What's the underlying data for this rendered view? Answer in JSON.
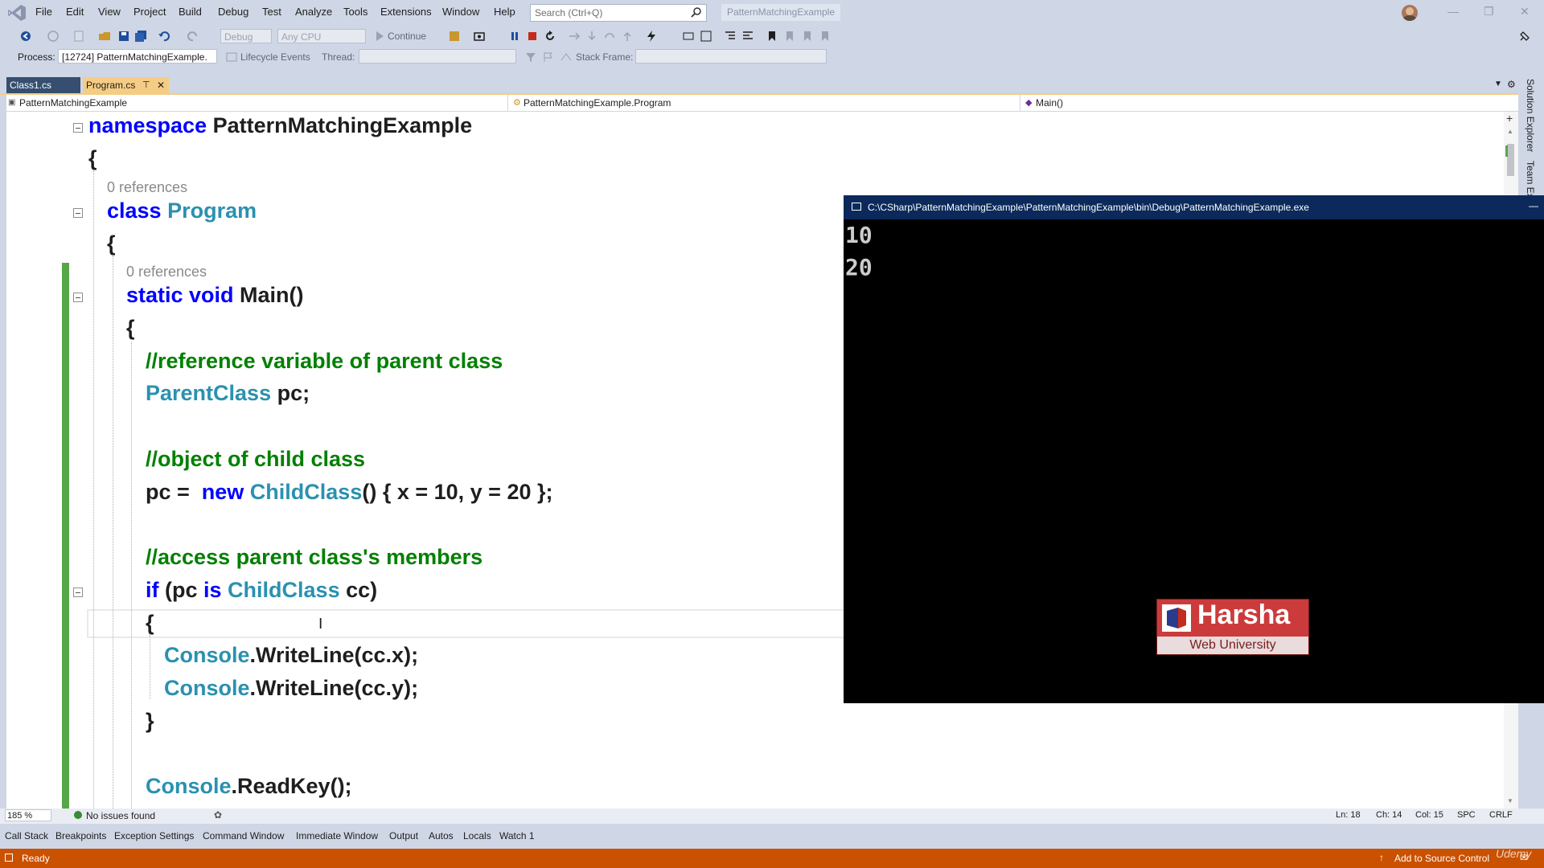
{
  "menubar": {
    "items": [
      "File",
      "Edit",
      "View",
      "Project",
      "Build",
      "Debug",
      "Test",
      "Analyze",
      "Tools",
      "Extensions",
      "Window",
      "Help"
    ],
    "search_placeholder": "Search (Ctrl+Q)",
    "solution_name": "PatternMatchingExample"
  },
  "toolbar": {
    "config": "Debug",
    "platform": "Any CPU",
    "continue_label": "Continue",
    "process_label": "Process:",
    "process_value": "[12724] PatternMatchingExample.",
    "lifecycle_label": "Lifecycle Events",
    "thread_label": "Thread:",
    "stack_frame_label": "Stack Frame:"
  },
  "tabs": {
    "class1": "Class1.cs",
    "program": "Program.cs"
  },
  "navbar": {
    "project": "PatternMatchingExample",
    "class": "PatternMatchingExample.Program",
    "member": "Main()"
  },
  "code": {
    "l1_kw": "namespace",
    "l1_name": " PatternMatchingExample",
    "brace_open": "{",
    "brace_close": "}",
    "refs": "0 references",
    "l3_kw": "class",
    "l3_name": " Program",
    "l5_kw": "static void",
    "l5_name": " Main()",
    "c1": "//reference variable of parent class",
    "l8_type": "ParentClass",
    "l8_rest": " pc;",
    "c2": "//object of child class",
    "l10_a": "pc =  ",
    "l10_kw": "new",
    "l10_type": " ChildClass",
    "l10_rest": "() { x = 10, y = 20 };",
    "c3": "//access parent class's members",
    "l12_kw1": "if",
    "l12_a": " (pc ",
    "l12_kw2": "is",
    "l12_type": " ChildClass",
    "l12_rest": " cc)",
    "console_type": "Console",
    "wl1": ".WriteLine(cc.x);",
    "wl2": ".WriteLine(cc.y);",
    "readkey": ".ReadKey();"
  },
  "console": {
    "title": "C:\\CSharp\\PatternMatchingExample\\PatternMatchingExample\\bin\\Debug\\PatternMatchingExample.exe",
    "lines": [
      "10",
      "20"
    ],
    "logo_main": "Harsha",
    "logo_sub": "Web University"
  },
  "editor_status": {
    "zoom": "185 %",
    "issues": "No issues found",
    "ln": "Ln: 18",
    "ch": "Ch: 14",
    "col": "Col: 15",
    "spc": "SPC",
    "crlf": "CRLF"
  },
  "toolwindows": [
    "Call Stack",
    "Breakpoints",
    "Exception Settings",
    "Command Window",
    "Immediate Window",
    "Output",
    "Autos",
    "Locals",
    "Watch 1"
  ],
  "sidetabs": {
    "solution_explorer": "Solution Explorer",
    "team_explorer": "Team Ex"
  },
  "statusbar": {
    "ready": "Ready",
    "source_control": "Add to Source Control",
    "watermark": "Udemy"
  }
}
